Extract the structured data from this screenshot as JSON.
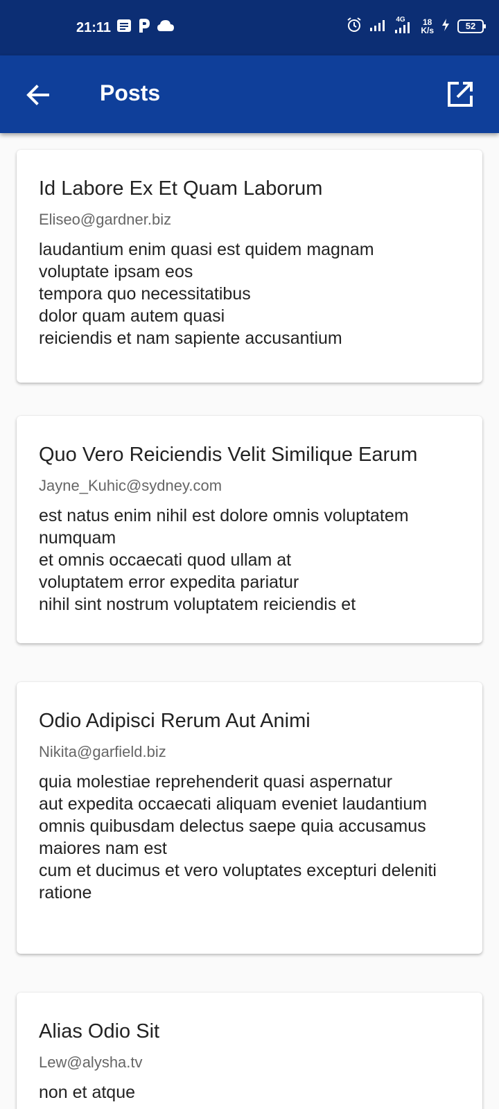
{
  "status_bar": {
    "time": "21:11",
    "network": "4G",
    "speed_value": "18",
    "speed_unit": "K/s",
    "battery": "52"
  },
  "app_bar": {
    "title": "Posts",
    "back_icon": "arrow-left-icon",
    "action_icon": "open-in-new-icon"
  },
  "posts": [
    {
      "title": "Id Labore Ex Et Quam Laborum",
      "email": "Eliseo@gardner.biz",
      "body": "laudantium enim quasi est quidem magnam\nvoluptate ipsam eos\ntempora quo necessitatibus\ndolor quam autem quasi\nreiciendis et nam sapiente accusantium"
    },
    {
      "title": "Quo Vero Reiciendis Velit Similique Earum",
      "email": "Jayne_Kuhic@sydney.com",
      "body": "est natus enim nihil est dolore omnis voluptatem numquam\net omnis occaecati quod ullam at\nvoluptatem error expedita pariatur\nnihil sint nostrum voluptatem reiciendis et"
    },
    {
      "title": "Odio Adipisci Rerum Aut Animi",
      "email": "Nikita@garfield.biz",
      "body": "quia molestiae reprehenderit quasi aspernatur\naut expedita occaecati aliquam eveniet laudantium\nomnis quibusdam delectus saepe quia accusamus maiores nam est\ncum et ducimus et vero voluptates excepturi deleniti ratione"
    },
    {
      "title": "Alias Odio Sit",
      "email": "Lew@alysha.tv",
      "body": "non et atque"
    }
  ]
}
